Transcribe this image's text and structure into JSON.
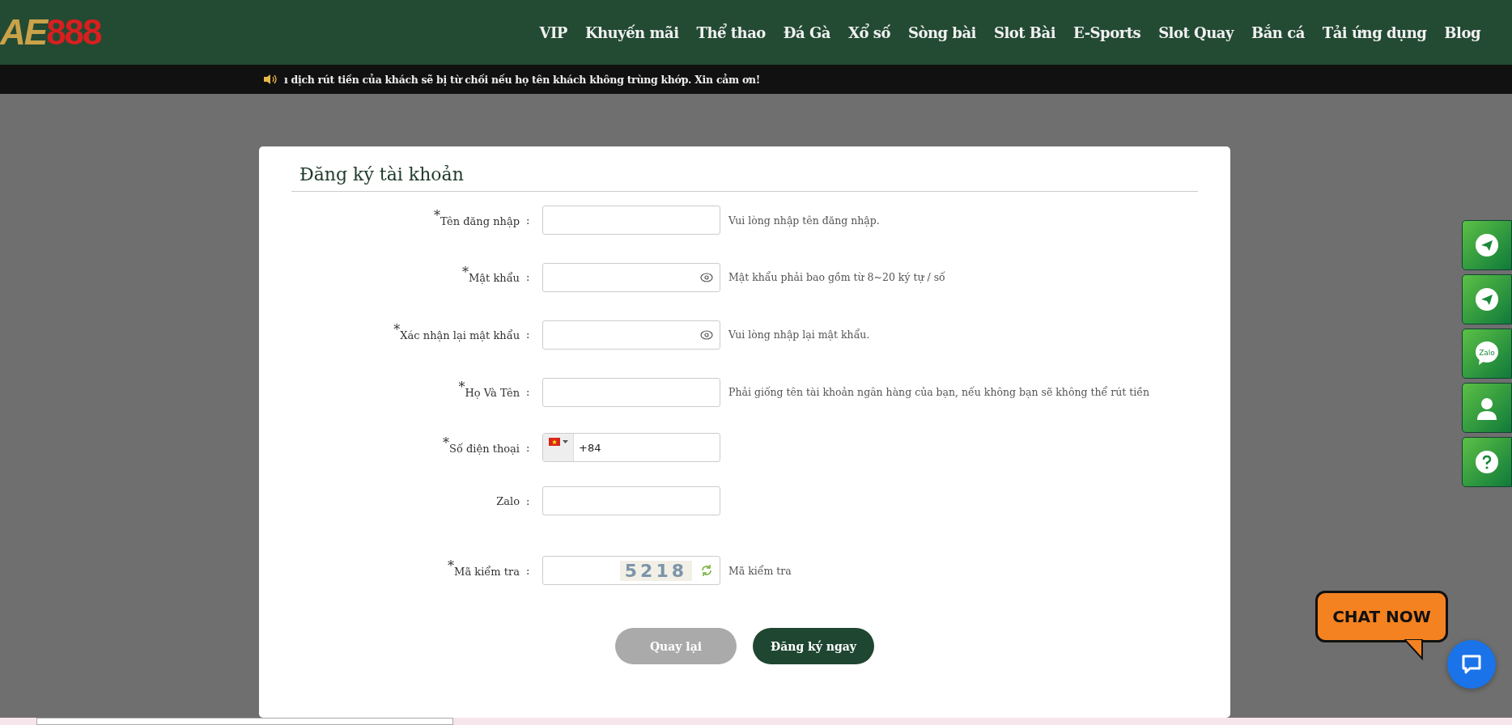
{
  "logo": {
    "mark": "AE",
    "number": "888"
  },
  "nav": [
    "VIP",
    "Khuyến mãi",
    "Thể thao",
    "Đá Gà",
    "Xổ số",
    "Sòng bài",
    "Slot Bài",
    "E-Sports",
    "Slot Quay",
    "Bắn cá",
    "Tải ứng dụng",
    "Blog"
  ],
  "ticker": "ı dịch rút tiền của khách sẽ bị từ chối nếu họ tên khách không trùng khớp. Xin cảm ơn!",
  "sidebar": [
    {
      "kind": "telegram"
    },
    {
      "kind": "telegram"
    },
    {
      "kind": "zalo",
      "text": "Zalo"
    },
    {
      "kind": "support"
    },
    {
      "kind": "help"
    }
  ],
  "form": {
    "title": "Đăng ký tài khoản",
    "required_mark": "*",
    "separator": ":",
    "fields": [
      {
        "kind": "text",
        "label": "Tên đăng nhập",
        "required": true,
        "hint": "Vui lòng nhập tên đăng nhập."
      },
      {
        "kind": "password",
        "label": "Mật khẩu",
        "required": true,
        "hint": "Mật khẩu phải bao gồm từ 8~20 ký tự / số"
      },
      {
        "kind": "password",
        "label": "Xác nhận lại mật khẩu",
        "required": true,
        "hint": "Vui lòng nhập lại mật khẩu."
      },
      {
        "kind": "text",
        "label": "Họ Và Tên",
        "required": true,
        "hint": "Phải giống tên tài khoản ngân hàng của bạn, nếu không bạn sẽ không thể rút tiền"
      },
      {
        "kind": "phone",
        "label": "Số điện thoại",
        "required": true,
        "value": "+84"
      },
      {
        "kind": "text",
        "label": "Zalo",
        "required": false
      },
      {
        "kind": "captcha",
        "label": "Mã kiểm tra",
        "required": true,
        "code": "5218",
        "hint": "Mã kiểm tra"
      }
    ],
    "buttons": [
      {
        "label": "Quay lại",
        "kind": "secondary"
      },
      {
        "label": "Đăng ký ngay",
        "kind": "primary"
      }
    ]
  },
  "chat": {
    "label": "CHAT NOW"
  }
}
